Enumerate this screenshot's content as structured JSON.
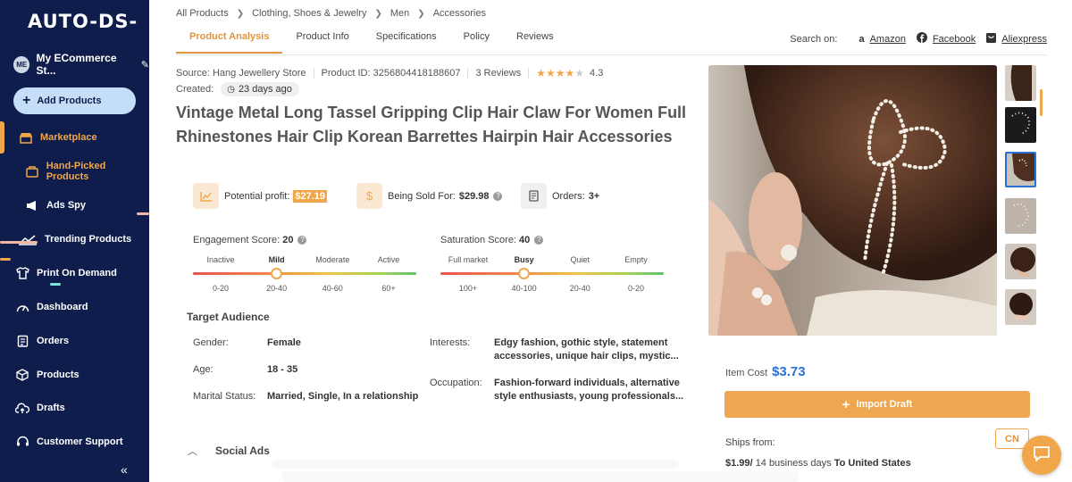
{
  "brand": {
    "logo": "AUTO-DS-"
  },
  "sidebar": {
    "store_avatar": "ME",
    "store_name": "My ECommerce St...",
    "add_products": "Add Products",
    "items": [
      {
        "label": "Marketplace",
        "icon": "store-icon",
        "active": true
      },
      {
        "label": "Hand-Picked Products",
        "icon": "bag-icon",
        "active": true
      },
      {
        "label": "Ads Spy",
        "icon": "megaphone-icon"
      },
      {
        "label": "Trending Products",
        "icon": "trend-chart-icon"
      },
      {
        "label": "Print On Demand",
        "icon": "shirt-icon"
      },
      {
        "label": "Dashboard",
        "icon": "gauge-icon"
      },
      {
        "label": "Orders",
        "icon": "clipboard-icon"
      },
      {
        "label": "Products",
        "icon": "box-icon"
      },
      {
        "label": "Drafts",
        "icon": "cloud-upload-icon"
      },
      {
        "label": "Customer Support",
        "icon": "headset-icon"
      }
    ],
    "collapse": "«"
  },
  "breadcrumb": [
    "All Products",
    "Clothing, Shoes & Jewelry",
    "Men",
    "Accessories"
  ],
  "tabs": [
    "Product Analysis",
    "Product Info",
    "Specifications",
    "Policy",
    "Reviews"
  ],
  "search_on": {
    "label": "Search on:",
    "sites": [
      "Amazon",
      "Facebook",
      "Aliexpress"
    ]
  },
  "product": {
    "source": "Source: Hang Jewellery Store",
    "product_id": "Product ID: 3256804418188607",
    "reviews": "3 Reviews",
    "rating": "4.3",
    "created_label": "Created:",
    "created_value": "23 days ago",
    "title": "Vintage Metal Long Tassel Gripping Clip Hair Claw For Women Full Rhinestones Hair Clip Korean Barrettes Hairpin Hair Accessories"
  },
  "stats": {
    "profit_label": "Potential profit:",
    "profit_value": "$27.19",
    "sold_label": "Being Sold For:",
    "sold_value": "$29.98",
    "orders_label": "Orders:",
    "orders_value": "3+"
  },
  "engagement": {
    "label": "Engagement Score:",
    "value": "20",
    "levels": [
      "Inactive",
      "Mild",
      "Moderate",
      "Active"
    ],
    "ranges": [
      "0-20",
      "20-40",
      "40-60",
      "60+"
    ],
    "selected": "Mild"
  },
  "saturation": {
    "label": "Saturation Score:",
    "value": "40",
    "levels": [
      "Full market",
      "Busy",
      "Quiet",
      "Empty"
    ],
    "ranges": [
      "100+",
      "40-100",
      "20-40",
      "0-20"
    ],
    "selected": "Busy"
  },
  "audience": {
    "title": "Target Audience",
    "gender_label": "Gender:",
    "gender": "Female",
    "age_label": "Age:",
    "age": "18 - 35",
    "marital_label": "Marital Status:",
    "marital": "Married, Single, In a relationship",
    "interests_label": "Interests:",
    "interests_line1": "Edgy fashion, gothic style, statement",
    "interests_line2": "accessories, unique hair clips, mystic...",
    "occupation_label": "Occupation:",
    "occupation_line1": "Fashion-forward individuals, alternative",
    "occupation_line2": "style enthusiasts, young professionals..."
  },
  "social_ads": "Social Ads",
  "purchase": {
    "item_cost_label": "Item Cost",
    "item_cost": "$3.73",
    "import_label": "Import Draft",
    "ships_from_label": "Ships from:",
    "ships_from_country": "CN",
    "shipping_price": "$1.99/",
    "shipping_days": " 14 business days ",
    "shipping_to": "To United States"
  },
  "colors": {
    "sidebar": "#0e1d4b",
    "accent": "#f2a64b",
    "price_blue": "#2a6fd6"
  }
}
